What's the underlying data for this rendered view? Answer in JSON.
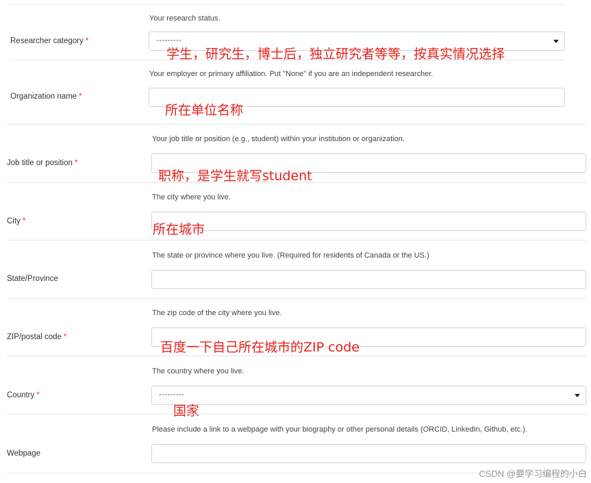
{
  "required_marker": "*",
  "fields": {
    "researcher_category": {
      "label": "Researcher category",
      "help": "Your research status.",
      "selected": "---------",
      "annotation": "学生，研究生，博士后，独立研究者等等，按真实情况选择"
    },
    "organization": {
      "label": "Organization name",
      "help": "Your employer or primary affiliation. Put \"None\" if you are an independent researcher.",
      "value": "",
      "annotation": "所在单位名称"
    },
    "job_title": {
      "label": "Job title or position",
      "help": "Your job title or position (e.g., student) within your institution or organization.",
      "value": "",
      "annotation": "职称，是学生就写student"
    },
    "city": {
      "label": "City",
      "help": "The city where you live.",
      "value": "",
      "annotation": "所在城市"
    },
    "state": {
      "label": "State/Province",
      "help": "The state or province where you live. (Required for residents of Canada or the US.)",
      "value": ""
    },
    "zip": {
      "label": "ZIP/postal code",
      "help": "The zip code of the city where you live.",
      "value": "",
      "annotation": "百度一下自己所在城市的ZIP code"
    },
    "country": {
      "label": "Country",
      "help": "The country where you live.",
      "selected": "---------",
      "annotation": "国家"
    },
    "webpage": {
      "label": "Webpage",
      "help": "Please include a link to a webpage with your biography or other personal details (ORCID, LinkedIn, Github, etc.).",
      "value": ""
    }
  },
  "watermark": "CSDN @要学习编程的小白",
  "colors": {
    "required": "#dc3545",
    "annotation": "#e8221b",
    "border": "#ced4da"
  }
}
